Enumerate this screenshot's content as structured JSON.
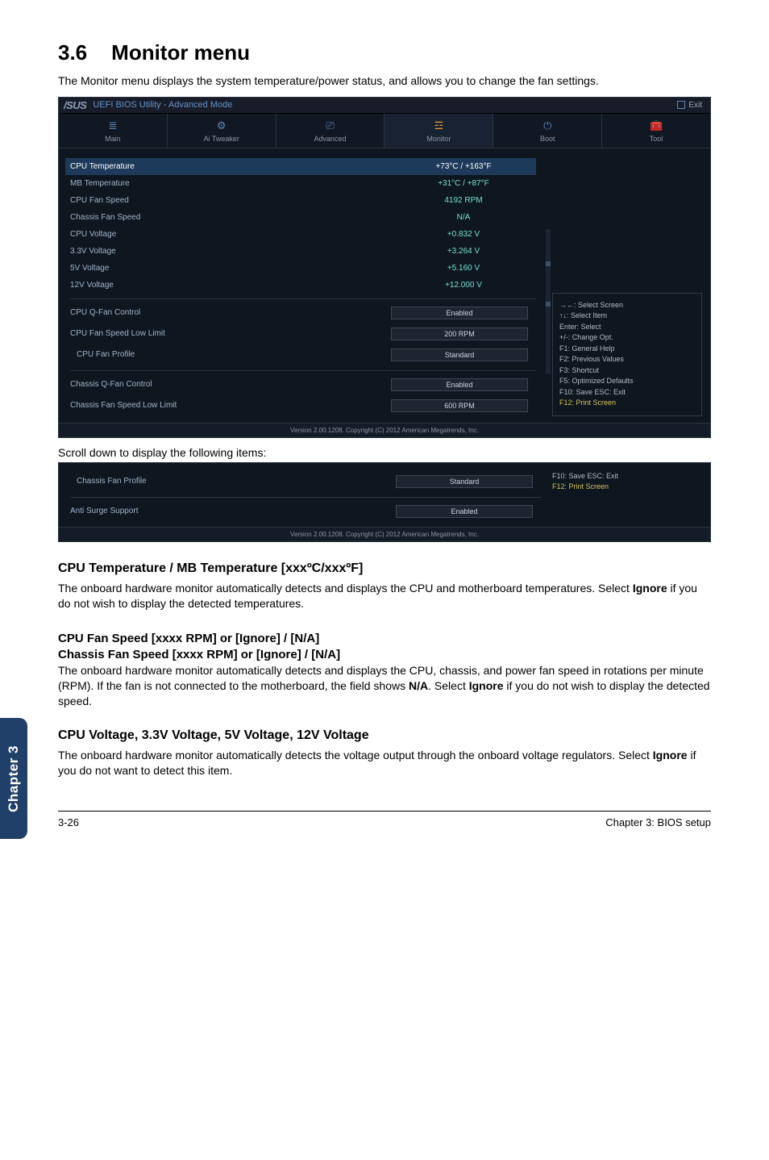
{
  "section": {
    "number": "3.6",
    "title": "Monitor menu"
  },
  "intro": "The Monitor menu displays the system temperature/power status, and allows you to change the fan settings.",
  "bios": {
    "titlebar": {
      "brand": "/SUS",
      "name": "UEFI BIOS Utility - Advanced Mode",
      "exit": "Exit"
    },
    "tabs": [
      {
        "label": "Main",
        "icon": "≣"
      },
      {
        "label": "Ai Tweaker",
        "icon": "⚙"
      },
      {
        "label": "Advanced",
        "icon": "⎚"
      },
      {
        "label": "Monitor",
        "icon": "☲"
      },
      {
        "label": "Boot",
        "icon": "⏻"
      },
      {
        "label": "Tool",
        "icon": "🧰"
      }
    ],
    "rows": [
      {
        "label": "CPU Temperature",
        "value": "+73°C / +163°F",
        "selected": true,
        "plain": true
      },
      {
        "label": "MB Temperature",
        "value": "+31°C / +87°F",
        "plain": true
      },
      {
        "label": "CPU Fan Speed",
        "value": "4192 RPM",
        "plain": true
      },
      {
        "label": "Chassis Fan Speed",
        "value": "N/A",
        "plain": true
      },
      {
        "label": "CPU Voltage",
        "value": "+0.832 V",
        "plain": true
      },
      {
        "label": "3.3V Voltage",
        "value": "+3.264 V",
        "plain": true
      },
      {
        "label": "5V Voltage",
        "value": "+5.160 V",
        "plain": true
      },
      {
        "label": "12V Voltage",
        "value": "+12.000 V",
        "plain": true
      }
    ],
    "rows2": [
      {
        "label": "CPU Q-Fan Control",
        "value": "Enabled"
      },
      {
        "label": "CPU Fan Speed Low Limit",
        "value": "200 RPM"
      },
      {
        "label": "CPU Fan Profile",
        "value": "Standard"
      }
    ],
    "rows3": [
      {
        "label": "Chassis Q-Fan Control",
        "value": "Enabled"
      },
      {
        "label": "Chassis Fan Speed Low Limit",
        "value": "600 RPM"
      }
    ],
    "help": {
      "l1": "→←: Select Screen",
      "l2": "↑↓: Select Item",
      "l3": "Enter: Select",
      "l4": "+/-: Change Opt.",
      "l5": "F1: General Help",
      "l6": "F2: Previous Values",
      "l7": "F3: Shortcut",
      "l8": "F5: Optimized Defaults",
      "l9": "F10: Save   ESC: Exit",
      "l10": "F12: Print Screen"
    },
    "footer": "Version 2.00.1208. Copyright (C) 2012 American Megatrends, Inc."
  },
  "scroll_note": "Scroll down to display the following items:",
  "bios2": {
    "rows": [
      {
        "label": "Chassis Fan Profile",
        "value": "Standard"
      },
      {
        "label": "Anti Surge Support",
        "value": "Enabled"
      }
    ],
    "help1": "F10: Save   ESC: Exit",
    "help2": "F12: Print Screen",
    "footer": "Version 2.00.1208. Copyright (C) 2012 American Megatrends, Inc."
  },
  "sec1": {
    "h": "CPU Temperature / MB Temperature [xxxºC/xxxºF]",
    "p": "The onboard hardware monitor automatically detects and displays the CPU and motherboard temperatures. Select Ignore if you do not wish to display the detected temperatures."
  },
  "sec2": {
    "h1": "CPU Fan Speed [xxxx RPM] or [Ignore] / [N/A]",
    "h2": "Chassis Fan Speed [xxxx RPM] or [Ignore] / [N/A]",
    "p": "The onboard hardware monitor automatically detects and displays the CPU, chassis, and power fan speed in rotations per minute (RPM). If the fan is not connected to the motherboard, the field shows N/A. Select Ignore if you do not wish to display the detected speed."
  },
  "sec3": {
    "h": "CPU Voltage, 3.3V Voltage, 5V Voltage, 12V Voltage",
    "p": "The onboard hardware monitor automatically detects the voltage output through the onboard voltage regulators. Select Ignore if you do not want to detect this item."
  },
  "chapter_tab": "Chapter 3",
  "footer": {
    "left": "3-26",
    "right": "Chapter 3: BIOS setup"
  }
}
